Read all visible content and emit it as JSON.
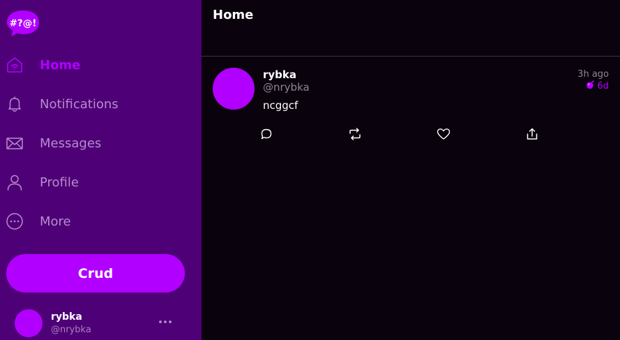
{
  "app": {
    "logo_text": "#?@!"
  },
  "sidebar": {
    "items": [
      {
        "label": "Home",
        "icon": "home-icon",
        "active": true
      },
      {
        "label": "Notifications",
        "icon": "bell-icon"
      },
      {
        "label": "Messages",
        "icon": "envelope-icon"
      },
      {
        "label": "Profile",
        "icon": "user-icon"
      },
      {
        "label": "More",
        "icon": "more-circle-icon"
      }
    ],
    "post_button_label": "Crud",
    "account": {
      "name": "rybka",
      "handle": "@nrybka"
    }
  },
  "header": {
    "title": "Home"
  },
  "feed": {
    "posts": [
      {
        "name": "rybka",
        "handle": "@nrybka",
        "time": "3h ago",
        "expiry": "6d",
        "text": "ncggcf",
        "actions": [
          "reply-icon",
          "repost-icon",
          "like-icon",
          "share-icon"
        ]
      }
    ]
  },
  "colors": {
    "accent": "#b100ff",
    "sidebar_bg": "#4e0077",
    "main_bg": "#0a020c",
    "muted_text": "#8e8693"
  }
}
